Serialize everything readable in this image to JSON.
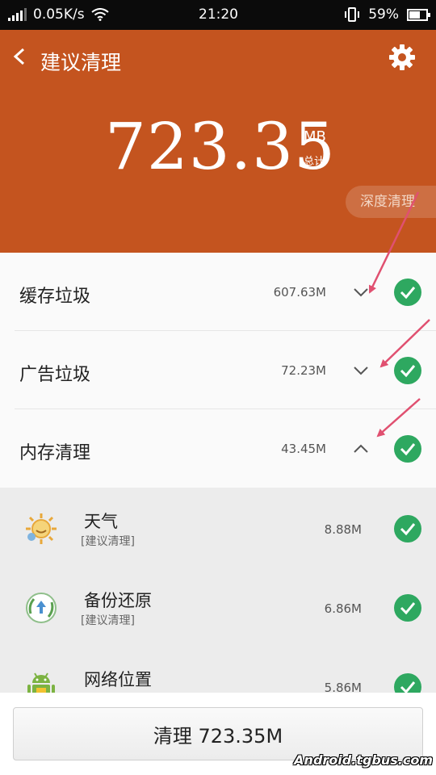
{
  "status_bar": {
    "network_speed": "0.05K/s",
    "time": "21:20",
    "battery": "59%"
  },
  "header": {
    "title": "建议清理",
    "total_value": "723.35",
    "total_unit": "MB",
    "total_caption": "总计",
    "deep_clean_label": "深度清理"
  },
  "categories": [
    {
      "label": "缓存垃圾",
      "size": "607.63M",
      "expanded": false,
      "checked": true
    },
    {
      "label": "广告垃圾",
      "size": "72.23M",
      "expanded": false,
      "checked": true
    },
    {
      "label": "内存清理",
      "size": "43.45M",
      "expanded": true,
      "checked": true
    }
  ],
  "apps": [
    {
      "name": "天气",
      "tag": "[建议清理]",
      "size": "8.88M",
      "icon": "weather-sun-icon",
      "checked": true
    },
    {
      "name": "备份还原",
      "tag": "[建议清理]",
      "size": "6.86M",
      "icon": "backup-restore-icon",
      "checked": true
    },
    {
      "name": "网络位置",
      "tag": "",
      "size": "5.86M",
      "icon": "android-robot-icon",
      "checked": true
    }
  ],
  "clean_button_label": "清理 723.35M",
  "watermark": "Android.tgbus.com",
  "colors": {
    "header_bg": "#c4541f",
    "check_green": "#2ea860",
    "annotation_arrow": "#e05070"
  }
}
